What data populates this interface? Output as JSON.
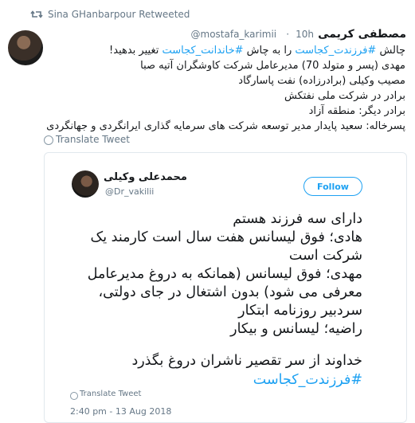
{
  "retweet": {
    "label": "Sina GHanbarpour Retweeted",
    "icon": "retweet-icon"
  },
  "tweet": {
    "display_name": "مصطفی کریمی",
    "handle": "@mostafa_karimii",
    "separator": "·",
    "time": "10h",
    "lines": [
      {
        "parts": [
          {
            "text": "چالش ",
            "link": false
          },
          {
            "text": "#فرزندت_کجاست",
            "link": true
          },
          {
            "text": " را به چاش ",
            "link": false
          },
          {
            "text": "#خاندانت_کجاست",
            "link": true
          },
          {
            "text": " تغییر بدهید!",
            "link": false
          }
        ]
      },
      {
        "parts": [
          {
            "text": "مهدی (پسر و متولد 70) مدیرعامل شرکت کاوشگران آتیه صبا",
            "link": false
          }
        ]
      },
      {
        "parts": [
          {
            "text": "مصیب وکیلی (برادرزاده)  نفت پاسارگاد",
            "link": false
          }
        ]
      },
      {
        "parts": [
          {
            "text": "برادر در شرکت ملی نفتکش",
            "link": false
          }
        ]
      },
      {
        "parts": [
          {
            "text": "برادر دیگر: منطقه آزاد",
            "link": false
          }
        ]
      },
      {
        "parts": [
          {
            "text": "پسرخاله: سعید پایدار مدیر توسعه شرکت های سرمایه گذاری ایرانگردی و جهانگردی",
            "link": false
          }
        ]
      }
    ],
    "translate_label": "Translate Tweet"
  },
  "quoted": {
    "display_name": "محمدعلی وکیلی",
    "handle": "@Dr_vakilii",
    "follow_label": "Follow",
    "lines": [
      {
        "text": "دارای سه فرزند هستم",
        "link": false
      },
      {
        "text": "هادی؛ فوق لیسانس هفت سال است کارمند یک",
        "link": false
      },
      {
        "text": "شرکت است",
        "link": false
      },
      {
        "text": "مهدی؛ فوق لیسانس (همانکه به دروغ مدیرعامل",
        "link": false
      },
      {
        "text": "معرفی می شود) بدون اشتغال در جای دولتی،",
        "link": false
      },
      {
        "text": "سردبیر روزنامه ابتکار",
        "link": false
      },
      {
        "text": "راضیه؛ لیسانس و بیکار",
        "link": false
      },
      {
        "text": "",
        "link": false
      },
      {
        "text": "خداوند از سر تقصیر ناشران دروغ بگذرد",
        "link": false
      },
      {
        "text": "#فرزندت_کجاست",
        "link": true
      }
    ],
    "translate_label": "Translate Tweet",
    "timestamp": "2:40 pm - 13 Aug 2018"
  },
  "colors": {
    "link": "#1da1f2",
    "muted": "#657786",
    "border": "#e1e8ed",
    "text": "#14171a"
  }
}
